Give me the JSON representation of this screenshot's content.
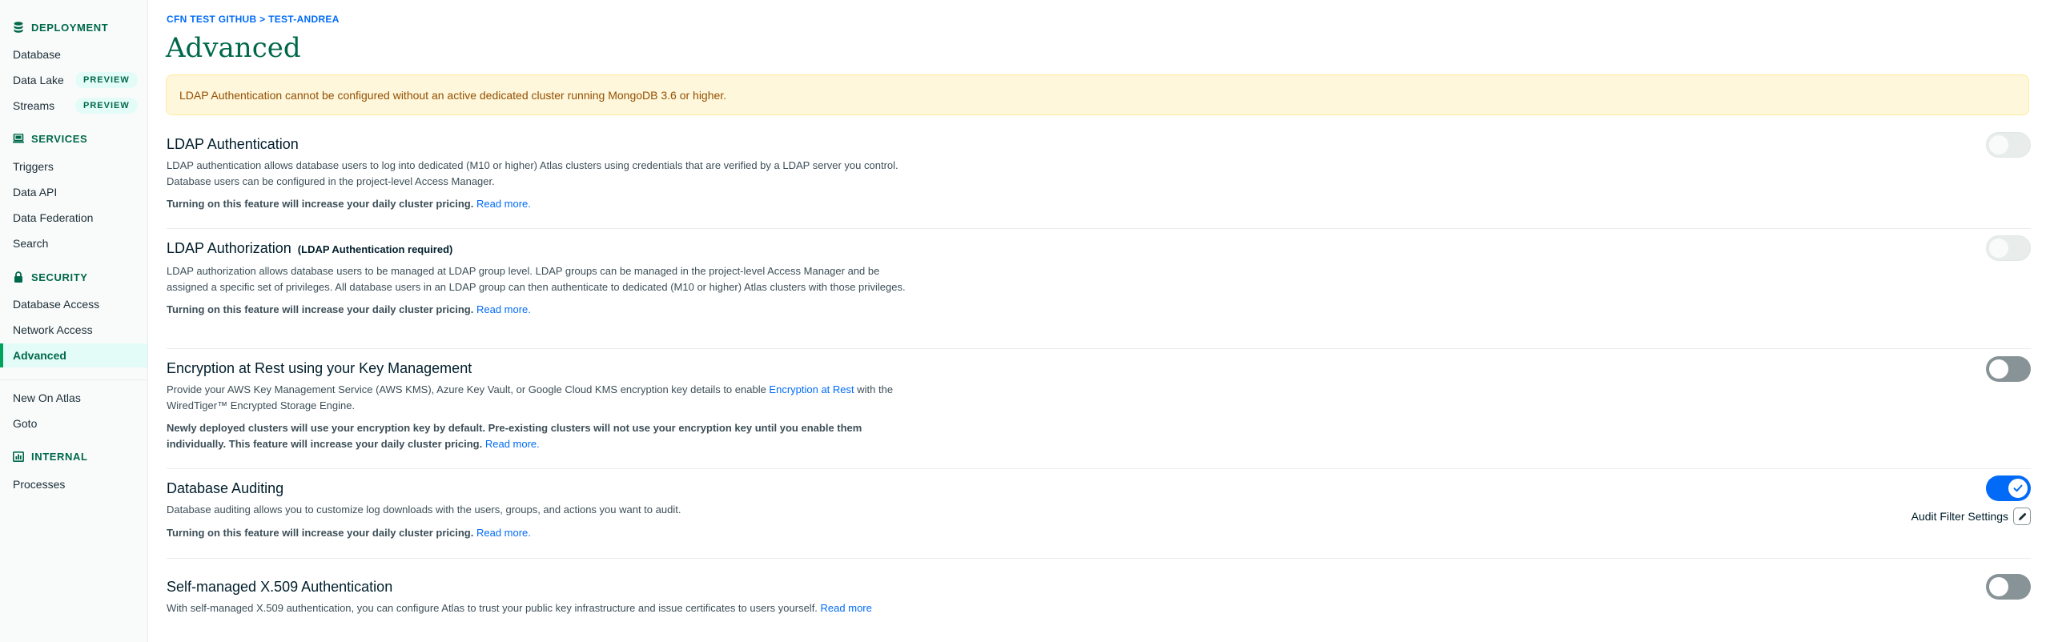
{
  "sidebar": {
    "sections": {
      "deployment": "DEPLOYMENT",
      "services": "SERVICES",
      "security": "SECURITY",
      "internal": "INTERNAL"
    },
    "items": {
      "database": "Database",
      "data_lake": "Data Lake",
      "streams": "Streams",
      "triggers": "Triggers",
      "data_api": "Data API",
      "data_federation": "Data Federation",
      "search": "Search",
      "database_access": "Database Access",
      "network_access": "Network Access",
      "advanced": "Advanced",
      "new_on_atlas": "New On Atlas",
      "goto": "Goto",
      "processes": "Processes"
    },
    "badges": {
      "preview": "PREVIEW"
    }
  },
  "breadcrumb": "CFN TEST GITHUB > TEST-ANDREA",
  "page_title": "Advanced",
  "banner": "LDAP Authentication cannot be configured without an active dedicated cluster running MongoDB 3.6 or higher.",
  "features": {
    "ldap_authentication": {
      "title": "LDAP Authentication",
      "description": "LDAP authentication allows database users to log into dedicated (M10 or higher) Atlas clusters using credentials that are verified by a LDAP server you control. Database users can be configured in the project-level Access Manager.",
      "note": "Turning on this feature will increase your daily cluster pricing.",
      "link": "Read more."
    },
    "ldap_authorization": {
      "title": "LDAP Authorization",
      "title_suffix": "(LDAP Authentication required)",
      "description": "LDAP authorization allows database users to be managed at LDAP group level. LDAP groups can be managed in the project-level Access Manager and be assigned a specific set of privileges. All database users in an LDAP group can then authenticate to dedicated (M10 or higher) Atlas clusters with those privileges.",
      "note": "Turning on this feature will increase your daily cluster pricing.",
      "link": "Read more."
    },
    "encryption_at_rest": {
      "title": "Encryption at Rest using your Key Management",
      "description_before": "Provide your AWS Key Management Service (AWS KMS), Azure Key Vault, or Google Cloud KMS encryption key details to enable ",
      "description_link": "Encryption at Rest",
      "description_after": " with the WiredTiger™ Encrypted Storage Engine.",
      "note": "Newly deployed clusters will use your encryption key by default. Pre-existing clusters will not use your encryption key until you enable them individually. This feature will increase your daily cluster pricing.",
      "link": "Read more."
    },
    "database_auditing": {
      "title": "Database Auditing",
      "description": "Database auditing allows you to customize log downloads with the users, groups, and actions you want to audit.",
      "note": "Turning on this feature will increase your daily cluster pricing.",
      "link": "Read more.",
      "audit_filter_label": "Audit Filter Settings"
    },
    "x509": {
      "title": "Self-managed X.509 Authentication",
      "description": "With self-managed X.509 authentication, you can configure Atlas to trust your public key infrastructure and issue certificates to users yourself.",
      "link": "Read more"
    }
  },
  "toggles": {
    "ldap_authentication": "disabled",
    "ldap_authorization": "disabled",
    "encryption_at_rest": "off",
    "database_auditing": "on",
    "x509": "off"
  },
  "colors": {
    "accent_green": "#00684a",
    "link_blue": "#016bf8",
    "banner_bg": "#fef7db",
    "banner_text": "#944f01",
    "toggle_off": "#889397"
  },
  "icons": {
    "deployment": "database-stack-icon",
    "services": "laptop-icon",
    "security": "lock-icon",
    "internal": "chart-icon",
    "check": "checkmark-icon",
    "edit": "pencil-icon"
  }
}
